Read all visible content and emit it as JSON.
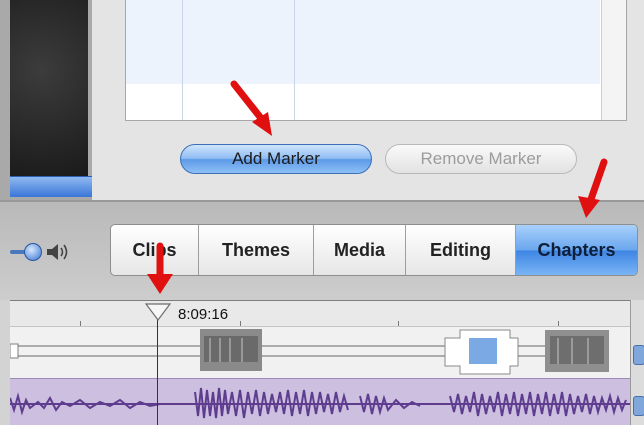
{
  "chapters_pane": {
    "add_marker_label": "Add Marker",
    "remove_marker_label": "Remove Marker"
  },
  "toolbar": {
    "tabs": [
      {
        "label": "Clips",
        "active": false
      },
      {
        "label": "Themes",
        "active": false
      },
      {
        "label": "Media",
        "active": false
      },
      {
        "label": "Editing",
        "active": false
      },
      {
        "label": "Chapters",
        "active": true
      }
    ]
  },
  "timeline": {
    "playhead_timecode": "8:09:16"
  },
  "colors": {
    "accent_blue": "#3f86e4",
    "annotation_red": "#e01010",
    "audio_waveform": "#5e3d8f"
  }
}
